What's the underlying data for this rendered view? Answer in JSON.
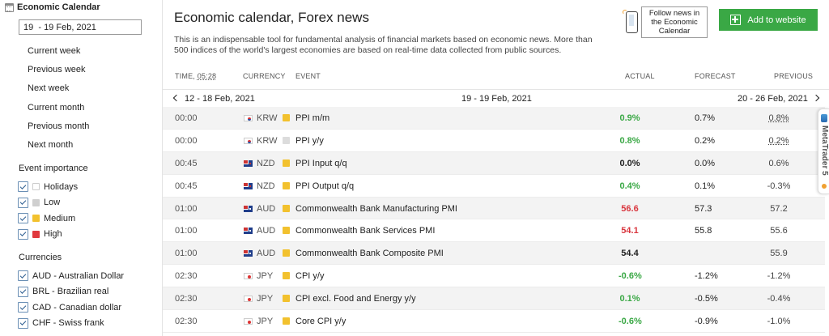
{
  "sidebar": {
    "title": "Economic Calendar",
    "date_range": "19  - 19 Feb, 2021",
    "periods": [
      "Current week",
      "Previous week",
      "Next week",
      "Current month",
      "Previous month",
      "Next month"
    ],
    "importance_title": "Event importance",
    "importance": [
      {
        "label": "Holidays",
        "color": "#ffffff"
      },
      {
        "label": "Low",
        "color": "#cfcfcf"
      },
      {
        "label": "Medium",
        "color": "#f2c12e"
      },
      {
        "label": "High",
        "color": "#e0393e"
      }
    ],
    "currencies_title": "Currencies",
    "currencies": [
      "AUD - Australian Dollar",
      "BRL - Brazilian real",
      "CAD - Canadian dollar",
      "CHF - Swiss frank"
    ]
  },
  "main": {
    "title": "Economic calendar, Forex news",
    "description": "This is an indispensable tool for fundamental analysis of financial markets based on economic news. More than 500 indices of the world's largest economies are based on real-time data collected from public sources.",
    "follow_text": "Follow news in the Economic Calendar",
    "add_button": "Add to website",
    "header": {
      "time_label": "TIME,",
      "time_value": "05:28",
      "currency": "CURRENCY",
      "event": "EVENT",
      "actual": "ACTUAL",
      "forecast": "FORECAST",
      "previous": "PREVIOUS"
    },
    "nav": {
      "prev_week": "12 - 18 Feb, 2021",
      "current": "19 - 19 Feb, 2021",
      "next_week": "20 - 26 Feb, 2021"
    },
    "colors": {
      "positive": "#3aa845",
      "negative": "#d9363e",
      "neutral": "#222222",
      "medium": "#f2c12e",
      "low": "#dcdcdc"
    },
    "rows": [
      {
        "time": "00:00",
        "flag": "kr",
        "currency": "KRW",
        "importance": "medium",
        "event": "PPI m/m",
        "actual": "0.9%",
        "actual_tone": "positive",
        "forecast": "0.7%",
        "previous": "0.8%",
        "prev_dotted": true
      },
      {
        "time": "00:00",
        "flag": "kr",
        "currency": "KRW",
        "importance": "low",
        "event": "PPI y/y",
        "actual": "0.8%",
        "actual_tone": "positive",
        "forecast": "0.2%",
        "previous": "0.2%",
        "prev_dotted": true
      },
      {
        "time": "00:45",
        "flag": "nz",
        "currency": "NZD",
        "importance": "medium",
        "event": "PPI Input q/q",
        "actual": "0.0%",
        "actual_tone": "neutral",
        "forecast": "0.0%",
        "previous": "0.6%",
        "prev_dotted": false
      },
      {
        "time": "00:45",
        "flag": "nz",
        "currency": "NZD",
        "importance": "medium",
        "event": "PPI Output q/q",
        "actual": "0.4%",
        "actual_tone": "positive",
        "forecast": "0.1%",
        "previous": "-0.3%",
        "prev_dotted": false
      },
      {
        "time": "01:00",
        "flag": "au",
        "currency": "AUD",
        "importance": "medium",
        "event": "Commonwealth Bank Manufacturing PMI",
        "actual": "56.6",
        "actual_tone": "negative",
        "forecast": "57.3",
        "previous": "57.2",
        "prev_dotted": false
      },
      {
        "time": "01:00",
        "flag": "au",
        "currency": "AUD",
        "importance": "medium",
        "event": "Commonwealth Bank Services PMI",
        "actual": "54.1",
        "actual_tone": "negative",
        "forecast": "55.8",
        "previous": "55.6",
        "prev_dotted": false
      },
      {
        "time": "01:00",
        "flag": "au",
        "currency": "AUD",
        "importance": "medium",
        "event": "Commonwealth Bank Composite PMI",
        "actual": "54.4",
        "actual_tone": "neutral",
        "forecast": "",
        "previous": "55.9",
        "prev_dotted": false
      },
      {
        "time": "02:30",
        "flag": "jp",
        "currency": "JPY",
        "importance": "medium",
        "event": "CPI y/y",
        "actual": "-0.6%",
        "actual_tone": "positive",
        "forecast": "-1.2%",
        "previous": "-1.2%",
        "prev_dotted": false
      },
      {
        "time": "02:30",
        "flag": "jp",
        "currency": "JPY",
        "importance": "medium",
        "event": "CPI excl. Food and Energy y/y",
        "actual": "0.1%",
        "actual_tone": "positive",
        "forecast": "-0.5%",
        "previous": "-0.4%",
        "prev_dotted": false
      },
      {
        "time": "02:30",
        "flag": "jp",
        "currency": "JPY",
        "importance": "medium",
        "event": "Core CPI y/y",
        "actual": "-0.6%",
        "actual_tone": "positive",
        "forecast": "-0.9%",
        "previous": "-1.0%",
        "prev_dotted": false
      }
    ]
  },
  "side_tab": {
    "label": "MetaTrader 5"
  }
}
